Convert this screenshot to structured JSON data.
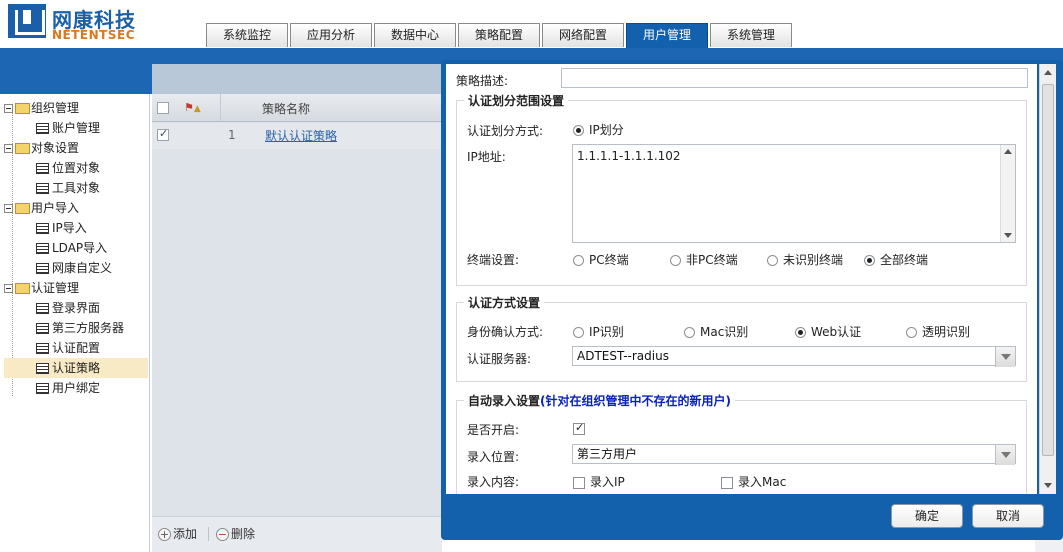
{
  "brand": {
    "name_cn": "网康科技",
    "name_en": "NETENTSEC"
  },
  "tabs": [
    {
      "label": "系统监控",
      "active": false
    },
    {
      "label": "应用分析",
      "active": false
    },
    {
      "label": "数据中心",
      "active": false
    },
    {
      "label": "策略配置",
      "active": false
    },
    {
      "label": "网络配置",
      "active": false
    },
    {
      "label": "用户管理",
      "active": true
    },
    {
      "label": "系统管理",
      "active": false
    }
  ],
  "tree": {
    "groups": [
      {
        "label": "组织管理",
        "children": [
          "账户管理"
        ]
      },
      {
        "label": "对象设置",
        "children": [
          "位置对象",
          "工具对象"
        ]
      },
      {
        "label": "用户导入",
        "children": [
          "IP导入",
          "LDAP导入",
          "网康自定义"
        ]
      },
      {
        "label": "认证管理",
        "children": [
          "登录界面",
          "第三方服务器",
          "认证配置",
          "认证策略",
          "用户绑定"
        ]
      }
    ],
    "selected": "认证策略"
  },
  "grid": {
    "column_name": "策略名称",
    "rows": [
      {
        "index": "1",
        "name": "默认认证策略",
        "checked": true
      }
    ],
    "footer": {
      "add": "添加",
      "delete": "删除"
    }
  },
  "dialog": {
    "desc_label": "策略描述:",
    "desc_value": "",
    "scope": {
      "legend": "认证划分范围设置",
      "method_label": "认证划分方式:",
      "method_value": "IP划分",
      "ip_label": "IP地址:",
      "ip_value": "1.1.1.1-1.1.1.102",
      "terminal_label": "终端设置:",
      "terminal_options": [
        "PC终端",
        "非PC终端",
        "未识别终端",
        "全部终端"
      ],
      "terminal_selected": "全部终端"
    },
    "auth": {
      "legend": "认证方式设置",
      "identity_label": "身份确认方式:",
      "identity_options": [
        "IP识别",
        "Mac识别",
        "Web认证",
        "透明识别"
      ],
      "identity_selected": "Web认证",
      "server_label": "认证服务器:",
      "server_value": "ADTEST--radius"
    },
    "auto": {
      "legend": "自动录入设置",
      "legend_note": "(针对在组织管理中不存在的新用户)",
      "enable_label": "是否开启:",
      "enabled": true,
      "location_label": "录入位置:",
      "location_value": "第三方用户",
      "content_label": "录入内容:",
      "content_options": [
        {
          "label": "录入IP",
          "checked": false
        },
        {
          "label": "录入Mac",
          "checked": false
        }
      ]
    },
    "ok_label": "确定",
    "cancel_label": "取消"
  }
}
